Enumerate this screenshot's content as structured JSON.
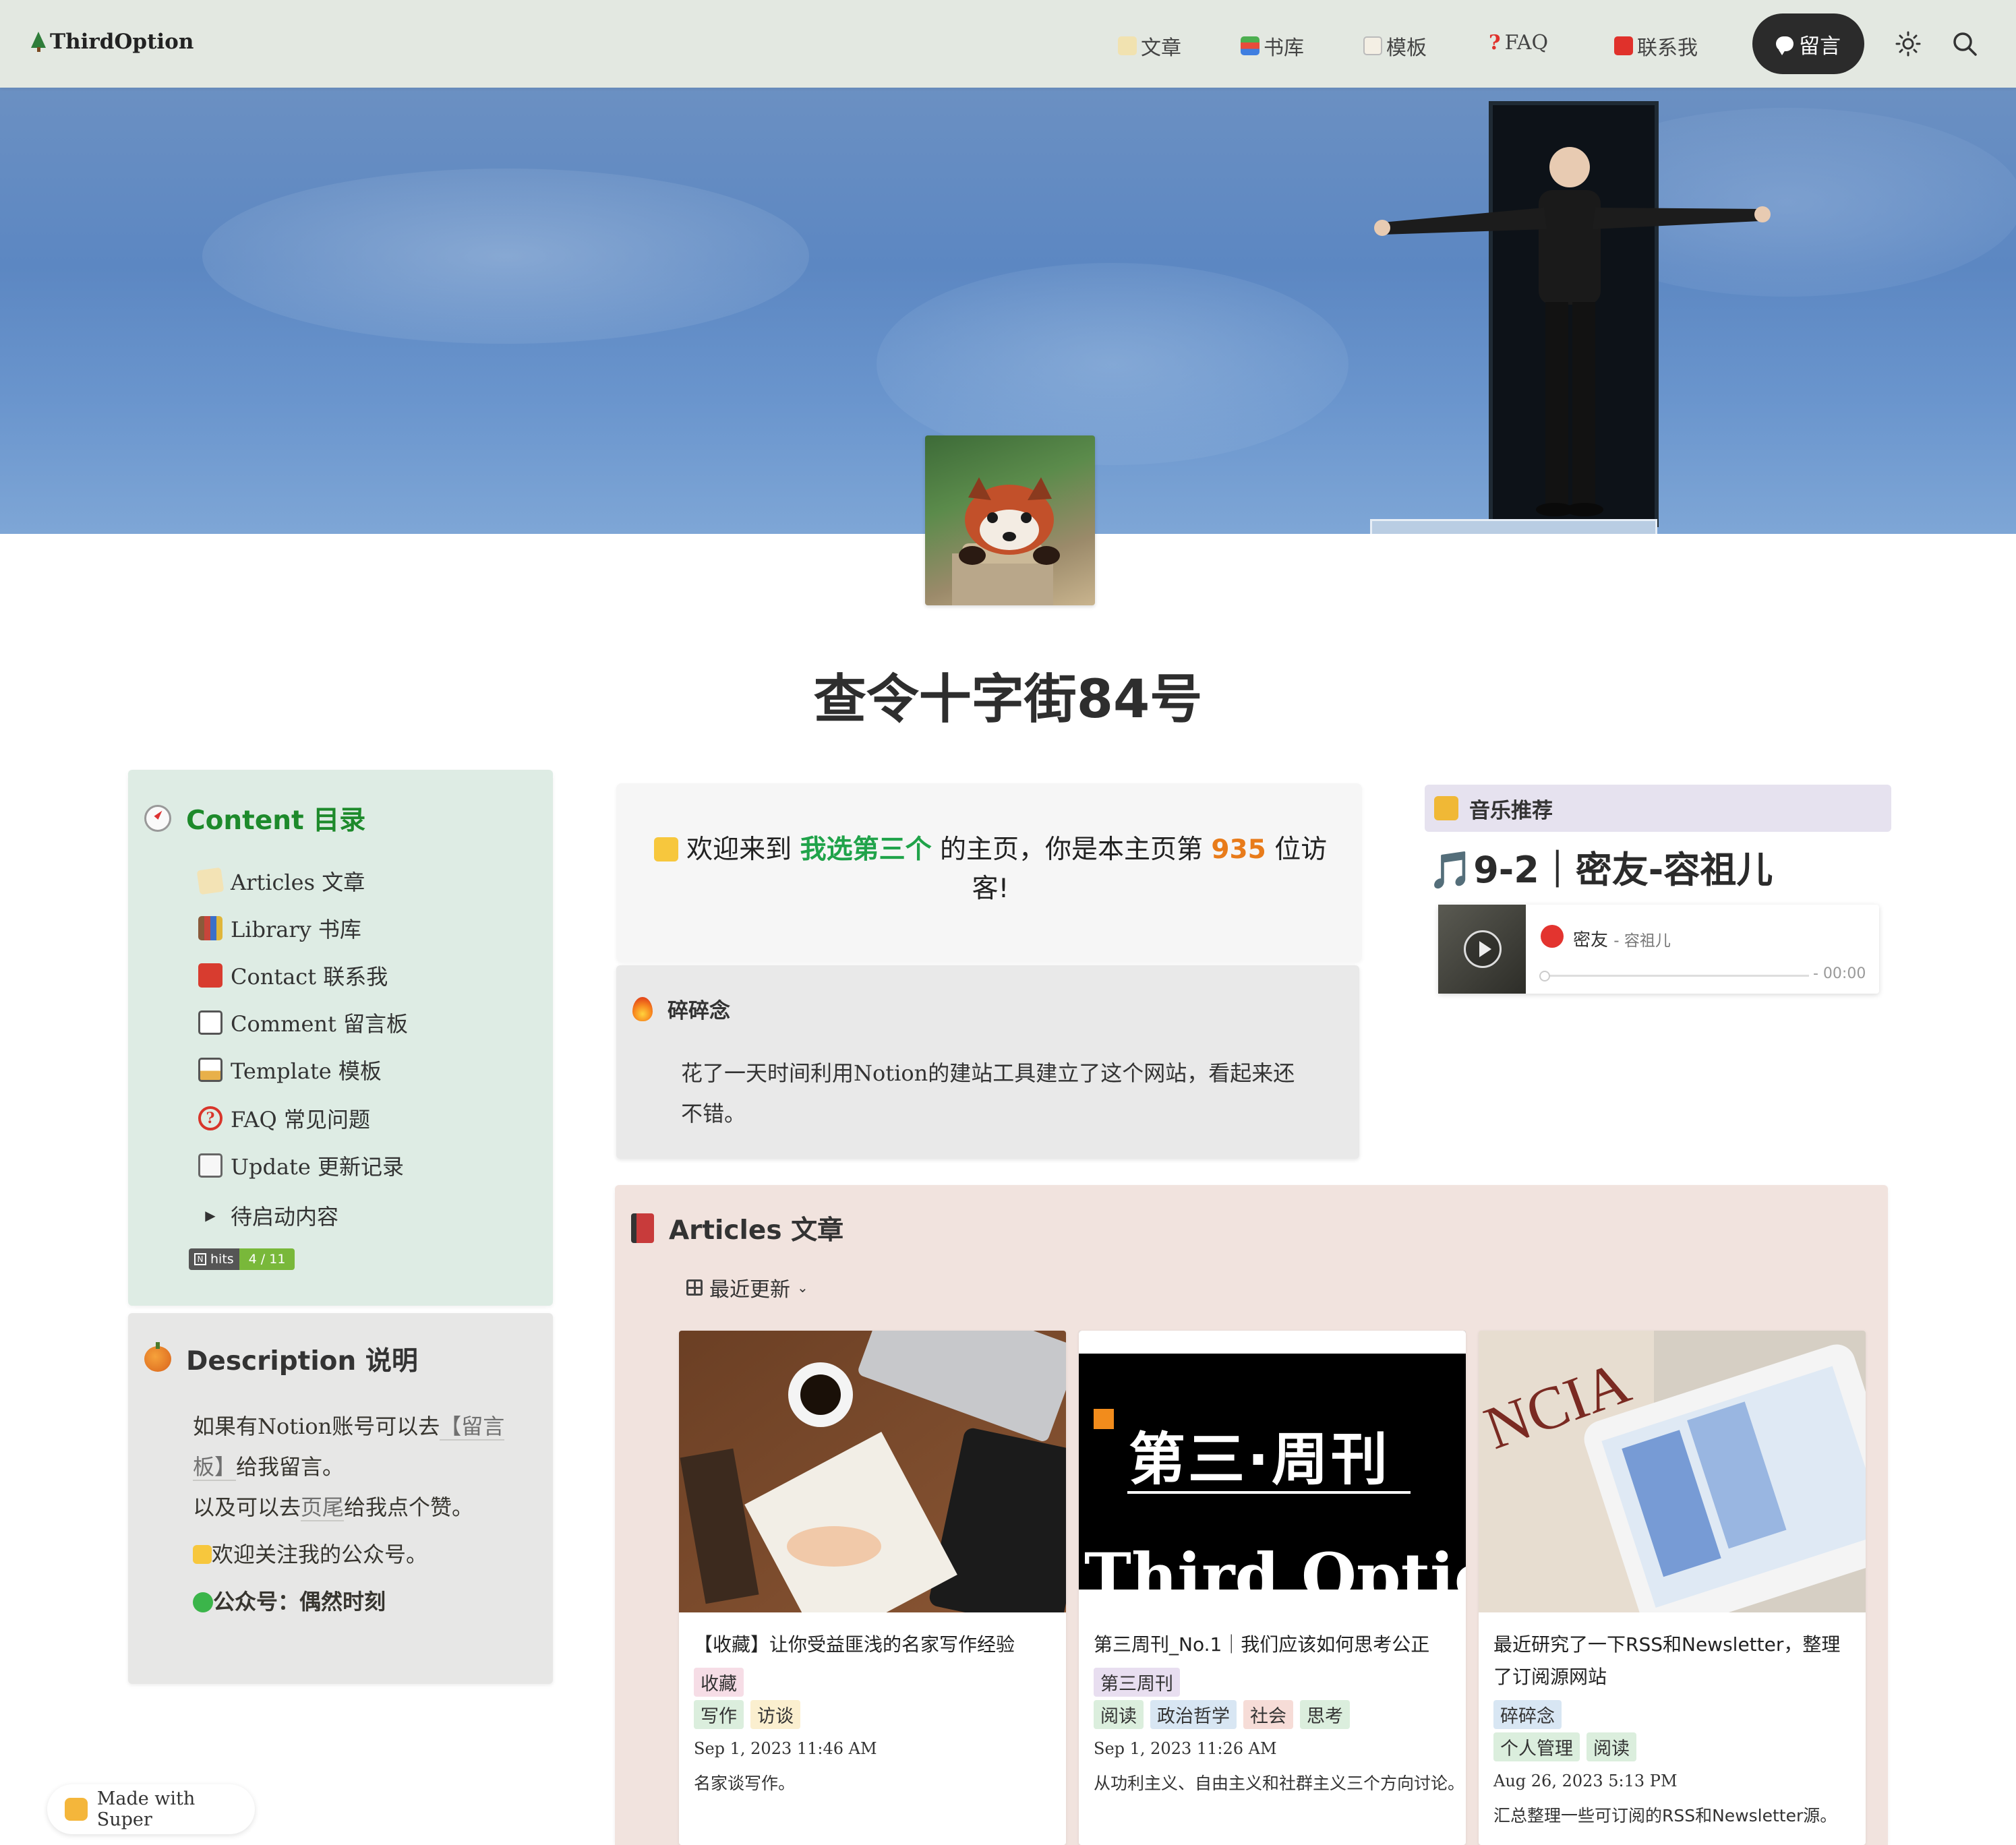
{
  "nav": {
    "brand": "ThirdOption",
    "items": [
      {
        "label": "文章",
        "icon": "memo-icon"
      },
      {
        "label": "书库",
        "icon": "books-icon"
      },
      {
        "label": "模板",
        "icon": "template-icon"
      },
      {
        "label": "FAQ",
        "icon": "question-icon"
      },
      {
        "label": "联系我",
        "icon": "mailbox-icon"
      }
    ],
    "button_label": "留言",
    "theme_icon": "sun-icon",
    "search_icon": "search-icon"
  },
  "page": {
    "title": "查令十字街84号"
  },
  "toc": {
    "heading": "Content 目录",
    "items": [
      {
        "label": "Articles 文章",
        "icon": "memo-icon"
      },
      {
        "label": "Library 书库",
        "icon": "books-icon"
      },
      {
        "label": "Contact 联系我",
        "icon": "mailbox-icon"
      },
      {
        "label": "Comment 留言板",
        "icon": "comment-board-icon"
      },
      {
        "label": "Template 模板",
        "icon": "template-icon"
      },
      {
        "label": "FAQ 常见问题",
        "icon": "question-icon"
      },
      {
        "label": "Update 更新记录",
        "icon": "update-log-icon"
      }
    ],
    "toggle_label": "待启动内容",
    "hits_label": "hits",
    "hits_value": "4 / 11"
  },
  "description": {
    "heading": "Description 说明",
    "line1_pre": "如果有Notion账号可以去",
    "line1_link": "【留言板】",
    "line1_post": "给我留言。",
    "line2_pre": "以及可以去",
    "line2_link": "页尾",
    "line2_post": "给我点个赞。",
    "line3": "欢迎关注我的公众号。",
    "line4": "公众号：偶然时刻"
  },
  "welcome": {
    "pre": "欢迎来到",
    "name": "我选第三个",
    "mid": "的主页，你是本主页第",
    "count": "935",
    "post": "位访客!"
  },
  "chatter": {
    "heading": "碎碎念",
    "body": "花了一天时间利用Notion的建站工具建立了这个网站，看起来还不错。"
  },
  "music": {
    "tag": "音乐推荐",
    "title": "🎵9-2｜密友-容祖儿",
    "song": "密友",
    "artist": "- 容祖儿",
    "time": "- 00:00",
    "progress": 0
  },
  "articles": {
    "heading": "Articles 文章",
    "view_label": "最近更新",
    "cards": [
      {
        "title": "【收藏】让你受益匪浅的名家写作经验",
        "tags1": [
          {
            "label": "收藏",
            "color": "#f6dde6"
          }
        ],
        "tags2": [
          {
            "label": "写作",
            "color": "#dbeedd"
          },
          {
            "label": "访谈",
            "color": "#fbefcf"
          }
        ],
        "date": "Sep 1, 2023 11:46 AM",
        "summary": "名家谈写作。"
      },
      {
        "title": "第三周刊_No.1｜我们应该如何思考公正",
        "tags1": [
          {
            "label": "第三周刊",
            "color": "#e8def0"
          }
        ],
        "tags2": [
          {
            "label": "阅读",
            "color": "#dbeedd"
          },
          {
            "label": "政治哲学",
            "color": "#d8e6f3"
          },
          {
            "label": "社会",
            "color": "#f6dcd7"
          },
          {
            "label": "思考",
            "color": "#dbeedd"
          }
        ],
        "date": "Sep 1, 2023 11:26 AM",
        "summary": "从功利主义、自由主义和社群主义三个方向讨论。"
      },
      {
        "title": "最近研究了一下RSS和Newsletter，整理了订阅源网站",
        "tags1": [
          {
            "label": "碎碎念",
            "color": "#d8e6f3"
          }
        ],
        "tags2": [
          {
            "label": "个人管理",
            "color": "#dbeedd"
          },
          {
            "label": "阅读",
            "color": "#dbeedd"
          }
        ],
        "date": "Aug 26, 2023 5:13 PM",
        "summary": "汇总整理一些可订阅的RSS和Newsletter源。"
      }
    ],
    "weekly_cover_title": "第三·周刊",
    "weekly_cover_sub": "Third Option"
  },
  "footer": {
    "made_with": "Made with Super"
  }
}
